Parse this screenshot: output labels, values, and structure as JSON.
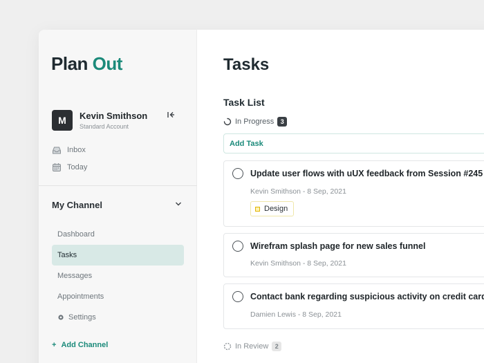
{
  "app": {
    "logo_part1": "Plan",
    "logo_part2": "Out"
  },
  "profile": {
    "initial": "M",
    "name": "Kevin Smithson",
    "account_type": "Standard Account"
  },
  "quick_links": [
    {
      "label": "Inbox",
      "icon": "inbox-icon"
    },
    {
      "label": "Today",
      "icon": "calendar-icon"
    }
  ],
  "channel": {
    "title": "My Channel",
    "items": [
      {
        "label": "Dashboard"
      },
      {
        "label": "Tasks",
        "active": true
      },
      {
        "label": "Messages"
      },
      {
        "label": "Appointments"
      },
      {
        "label": "Settings",
        "icon": "gear-icon"
      }
    ],
    "add_label": "Add Channel"
  },
  "main": {
    "title": "Tasks",
    "list_title": "Task List",
    "in_progress": {
      "label": "In Progress",
      "count": "3"
    },
    "add_task_label": "Add Task",
    "tasks": [
      {
        "title": "Update user flows with uUX feedback from Session #245",
        "meta": "Kevin Smithson - 8 Sep, 2021",
        "tag": "Design"
      },
      {
        "title": "Wirefram splash page for new sales funnel",
        "meta": "Kevin Smithson - 8 Sep, 2021"
      },
      {
        "title": "Contact bank regarding suspicious activity on credit card",
        "meta": "Damien Lewis - 8 Sep, 2021"
      }
    ],
    "in_review": {
      "label": "In Review",
      "count": "2"
    }
  },
  "colors": {
    "accent": "#1b8a7a",
    "active_bg": "#d8e9e6",
    "tag_yellow": "#e0b400"
  }
}
